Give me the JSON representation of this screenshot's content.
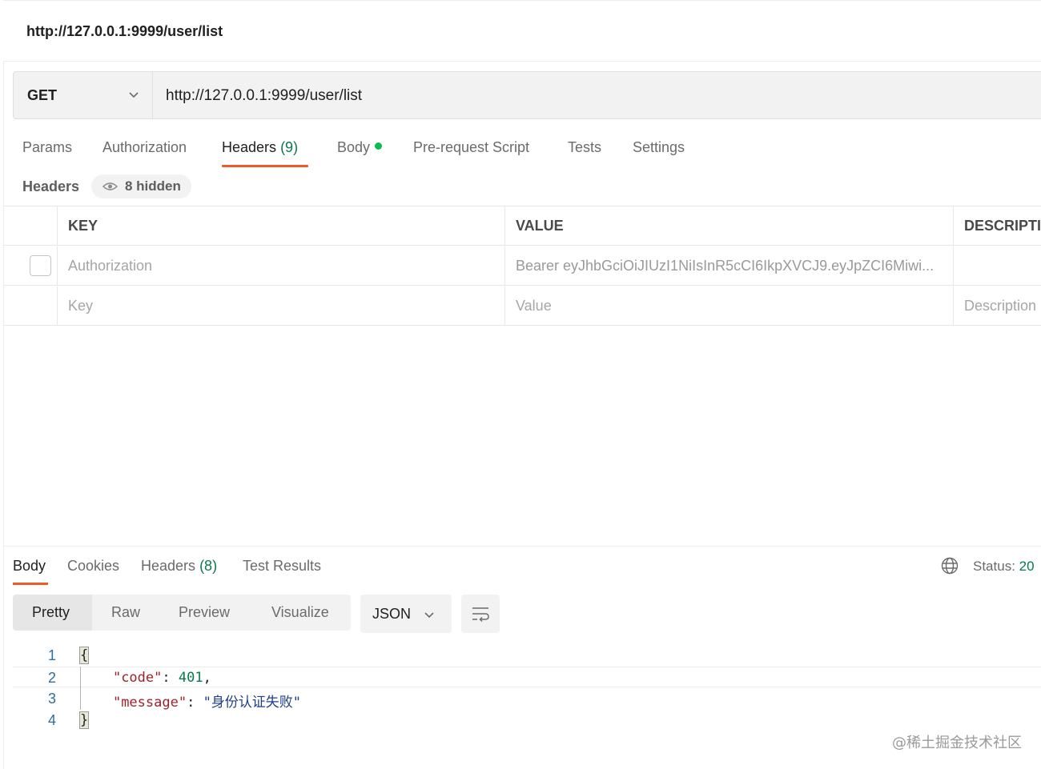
{
  "request": {
    "title": "http://127.0.0.1:9999/user/list",
    "method": "GET",
    "url": "http://127.0.0.1:9999/user/list"
  },
  "request_tabs": [
    {
      "label": "Params"
    },
    {
      "label": "Authorization"
    },
    {
      "label": "Headers",
      "count": "(9)"
    },
    {
      "label": "Body"
    },
    {
      "label": "Pre-request Script"
    },
    {
      "label": "Tests"
    },
    {
      "label": "Settings"
    }
  ],
  "headers_section": {
    "label": "Headers",
    "hidden_label": "8 hidden"
  },
  "headers_table": {
    "columns": [
      "KEY",
      "VALUE",
      "DESCRIPTI"
    ],
    "rows": [
      {
        "key": "Authorization",
        "value": "Bearer eyJhbGciOiJIUzI1NiIsInR5cCI6IkpXVCJ9.eyJpZCI6Miwi..."
      }
    ],
    "placeholder": {
      "key": "Key",
      "value": "Value",
      "description": "Description"
    }
  },
  "response_tabs": [
    {
      "label": "Body"
    },
    {
      "label": "Cookies"
    },
    {
      "label": "Headers",
      "count": "(8)"
    },
    {
      "label": "Test Results"
    }
  ],
  "status": {
    "label": "Status:",
    "code": "20"
  },
  "view_modes": [
    "Pretty",
    "Raw",
    "Preview",
    "Visualize"
  ],
  "format": "JSON",
  "response_body": {
    "line_numbers": [
      "1",
      "2",
      "3",
      "4"
    ],
    "open_brace": "{",
    "close_brace": "}",
    "code_key": "\"code\"",
    "code_value": "401",
    "message_key": "\"message\"",
    "message_value": "\"身份认证失败\""
  },
  "watermark": "@稀土掘金技术社区",
  "colors": {
    "accent": "#ef5b25",
    "success": "#0cbb52",
    "count": "#0a7a4a"
  }
}
